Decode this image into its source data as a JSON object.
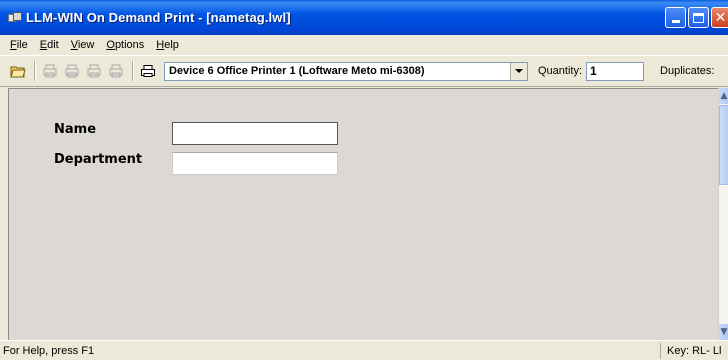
{
  "window": {
    "title": "LLM-WIN On Demand Print - [nametag.lwl]"
  },
  "menu": {
    "items": [
      {
        "label": "File",
        "mnemonic": "F",
        "rest": "ile"
      },
      {
        "label": "Edit",
        "mnemonic": "E",
        "rest": "dit"
      },
      {
        "label": "View",
        "mnemonic": "V",
        "rest": "iew"
      },
      {
        "label": "Options",
        "mnemonic": "O",
        "rest": "ptions"
      },
      {
        "label": "Help",
        "mnemonic": "H",
        "rest": "elp"
      }
    ]
  },
  "toolbar": {
    "device_value": "Device 6 Office Printer 1 (Loftware Meto mi-6308)",
    "quantity_label": "Quantity:",
    "quantity_value": "1",
    "duplicates_label": "Duplicates:"
  },
  "form": {
    "name_label": "Name",
    "name_value": "",
    "department_label": "Department",
    "department_value": ""
  },
  "status": {
    "help_text": "For Help, press F1",
    "key_text": "Key: RL- Ll"
  },
  "colors": {
    "titlebar": "#0055E5",
    "chrome": "#ECE9D8",
    "canvas": "#DCD8D4",
    "close_button": "#C8401C"
  }
}
